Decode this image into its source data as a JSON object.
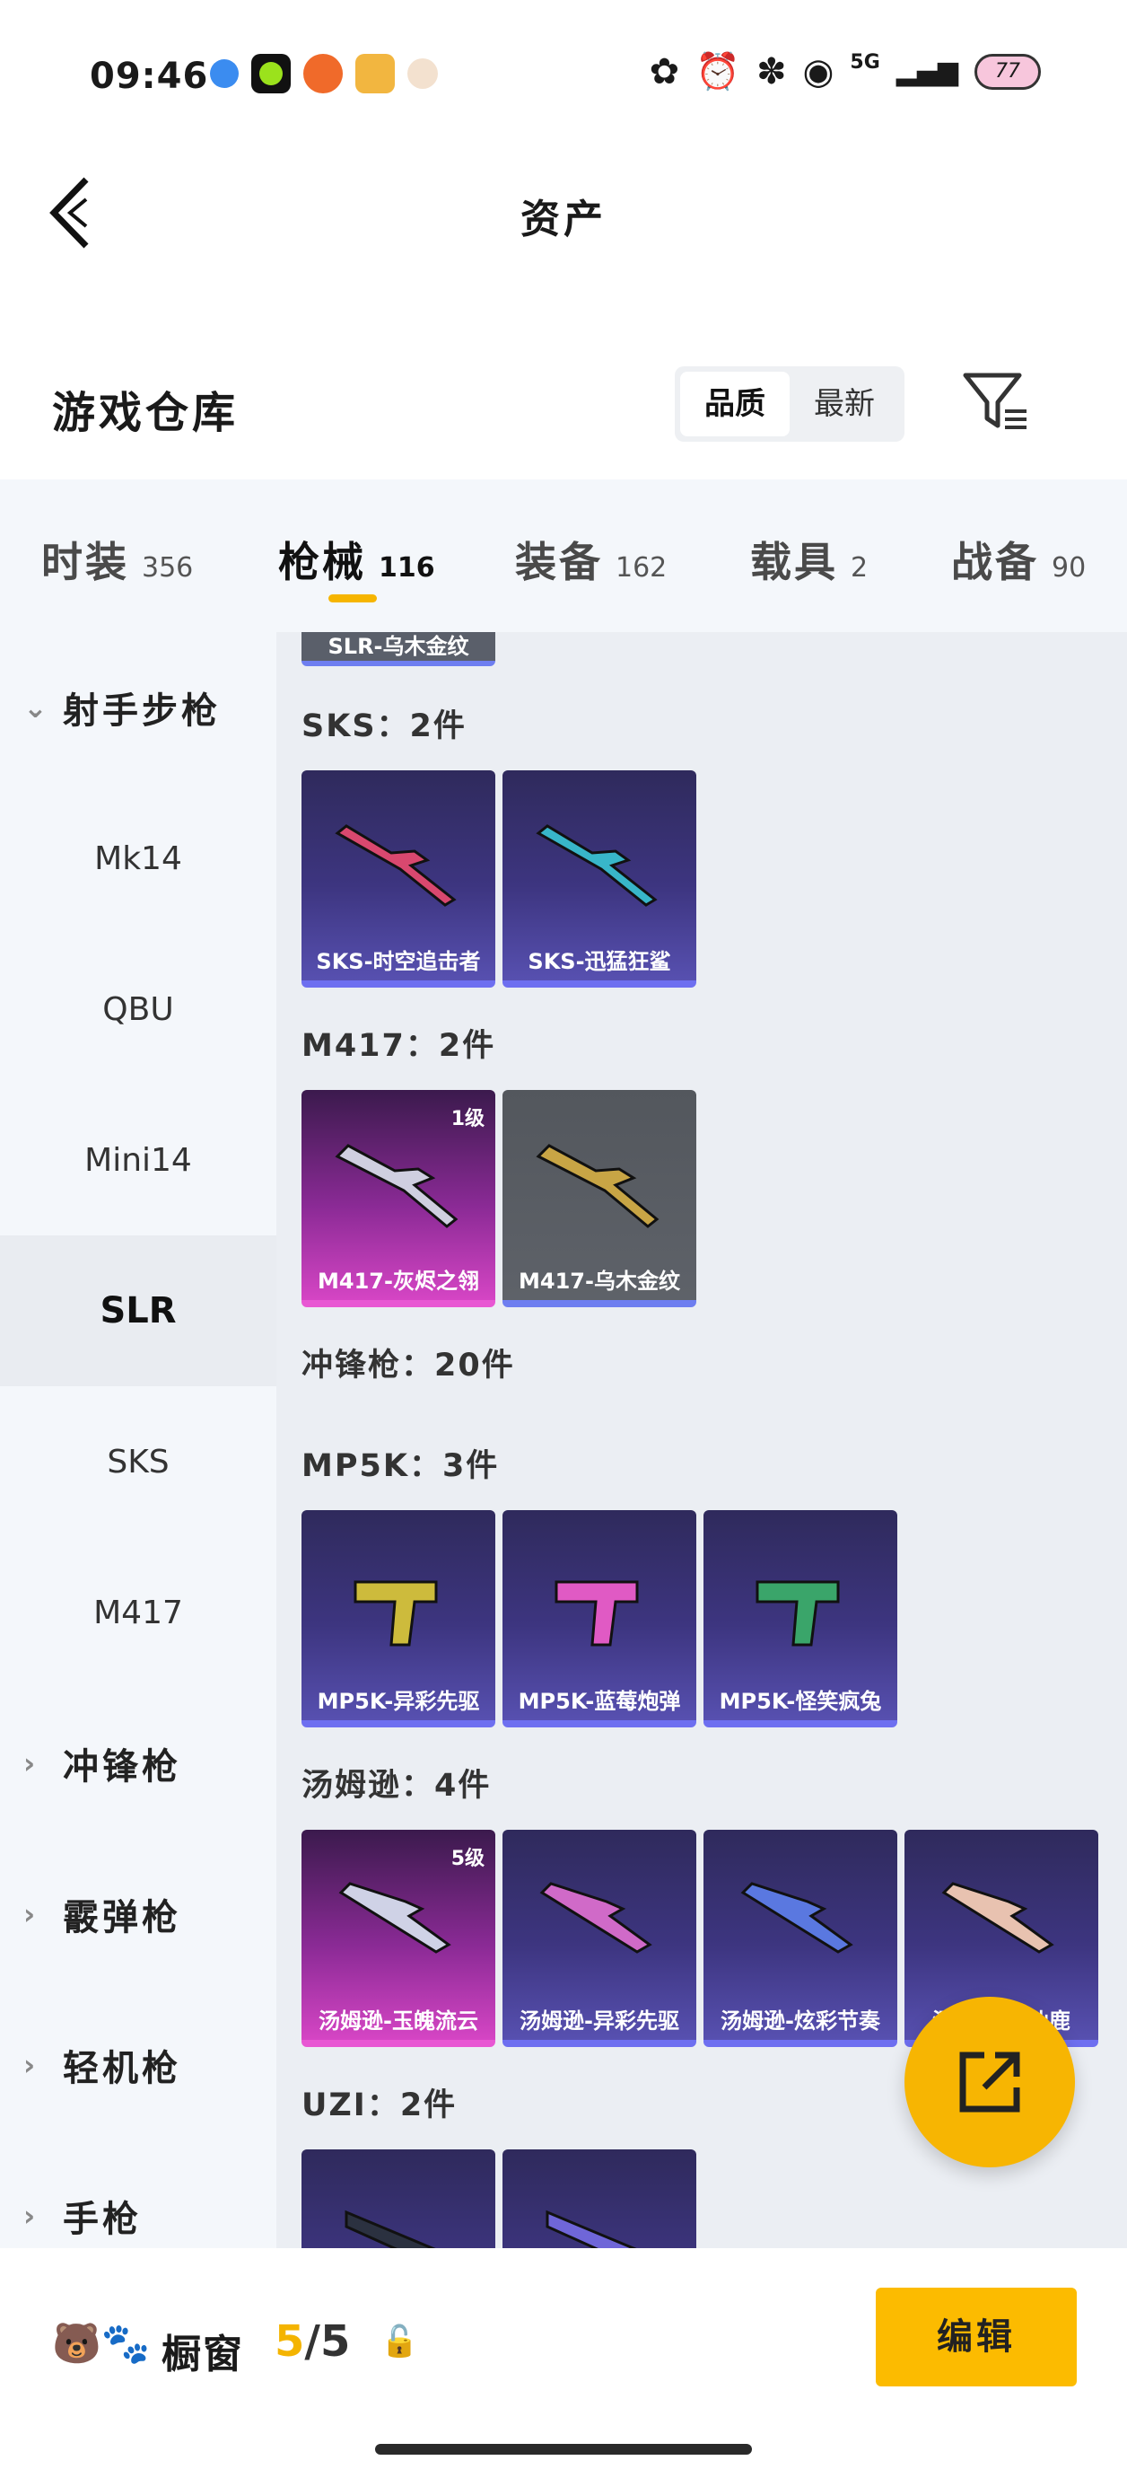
{
  "status_bar": {
    "time": "09:46",
    "network": "5G",
    "battery": "77"
  },
  "header": {
    "title": "资产"
  },
  "warehouse": {
    "title": "游戏仓库",
    "sort_options": [
      "品质",
      "最新"
    ],
    "active_sort": "品质"
  },
  "tabs": [
    {
      "label": "时装",
      "count": "356"
    },
    {
      "label": "枪械",
      "count": "116"
    },
    {
      "label": "装备",
      "count": "162"
    },
    {
      "label": "载具",
      "count": "2"
    },
    {
      "label": "战备",
      "count": "90"
    }
  ],
  "active_tab": "枪械",
  "sidebar": {
    "items": [
      {
        "label": "射手步枪",
        "type": "group",
        "expanded": true
      },
      {
        "label": "Mk14",
        "type": "item"
      },
      {
        "label": "QBU",
        "type": "item"
      },
      {
        "label": "Mini14",
        "type": "item"
      },
      {
        "label": "SLR",
        "type": "item",
        "selected": true
      },
      {
        "label": "SKS",
        "type": "item"
      },
      {
        "label": "M417",
        "type": "item"
      },
      {
        "label": "冲锋枪",
        "type": "group"
      },
      {
        "label": "霰弹枪",
        "type": "group"
      },
      {
        "label": "轻机枪",
        "type": "group"
      },
      {
        "label": "手枪",
        "type": "group"
      }
    ]
  },
  "content": {
    "partial_top_item": "SLR-乌木金纹",
    "groups": [
      {
        "title": "SKS：2件",
        "items": [
          {
            "name": "SKS-时空追击者",
            "rarity": "purple"
          },
          {
            "name": "SKS-迅猛狂鲨",
            "rarity": "purple"
          }
        ]
      },
      {
        "title": "M417：2件",
        "items": [
          {
            "name": "M417-灰烬之翎",
            "rarity": "pink",
            "level": "1级"
          },
          {
            "name": "M417-乌木金纹",
            "rarity": "gray"
          }
        ]
      },
      {
        "title": "冲锋枪：20件",
        "items": []
      },
      {
        "title": "MP5K：3件",
        "items": [
          {
            "name": "MP5K-异彩先驱",
            "rarity": "purple"
          },
          {
            "name": "MP5K-蓝莓炮弹",
            "rarity": "purple"
          },
          {
            "name": "MP5K-怪笑疯兔",
            "rarity": "purple"
          }
        ]
      },
      {
        "title": "汤姆逊：4件",
        "items": [
          {
            "name": "汤姆逊-玉魄流云",
            "rarity": "pink",
            "level": "5级"
          },
          {
            "name": "汤姆逊-异彩先驱",
            "rarity": "purple"
          },
          {
            "name": "汤姆逊-炫彩节奏",
            "rarity": "purple"
          },
          {
            "name": "汤姆逊-…仙鹿",
            "rarity": "purple"
          }
        ]
      },
      {
        "title": "UZI：2件",
        "items": [
          {
            "name": "",
            "rarity": "purple"
          },
          {
            "name": "",
            "rarity": "purple"
          }
        ]
      }
    ]
  },
  "bottom_bar": {
    "showcase_label": "橱窗",
    "current": "5",
    "separator": "/",
    "total": "5",
    "edit_label": "编辑"
  },
  "colors": {
    "accent": "#f7b502",
    "edit_button": "#fcbb00",
    "rarity_purple": "#3d3580",
    "rarity_pink": "#d545c4",
    "rarity_gray": "#5e6269"
  }
}
